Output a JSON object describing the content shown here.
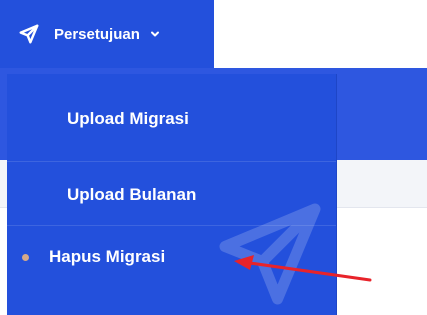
{
  "nav": {
    "label": "Persetujuan",
    "icon": "send-icon",
    "chevron_icon": "chevron-down-icon"
  },
  "dropdown": {
    "items": [
      {
        "label": "Upload Migrasi"
      },
      {
        "label": "Upload Bulanan"
      },
      {
        "label": "Hapus Migrasi",
        "active": true
      }
    ],
    "watermark_icon": "send-icon"
  },
  "colors": {
    "menu_bg": "#2350dc",
    "active_bullet": "#d5a98a",
    "annotation": "#e8232a"
  }
}
